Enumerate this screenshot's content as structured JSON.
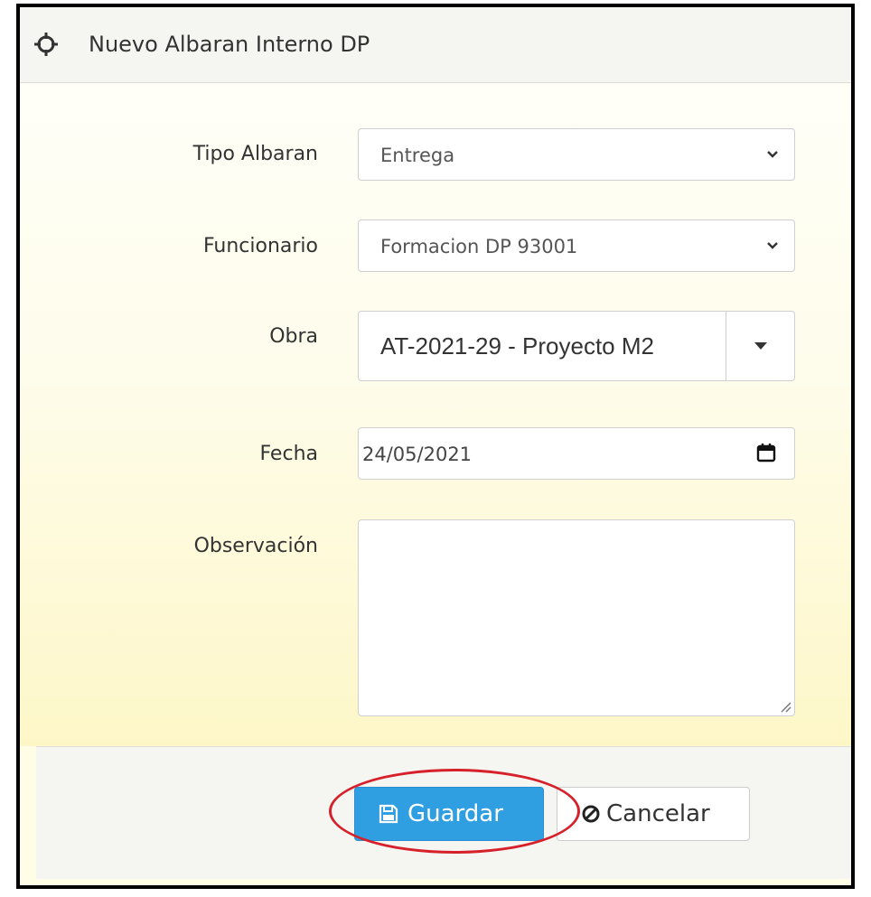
{
  "dialog": {
    "title": "Nuevo Albaran Interno DP",
    "title_icon": "crosshairs-icon"
  },
  "form": {
    "tipo_albaran": {
      "label": "Tipo Albaran",
      "value": "Entrega"
    },
    "funcionario": {
      "label": "Funcionario",
      "value": "Formacion DP 93001"
    },
    "obra": {
      "label": "Obra",
      "value": "AT-2021-29 - Proyecto M2"
    },
    "fecha": {
      "label": "Fecha",
      "value": "24/05/2021"
    },
    "observacion": {
      "label": "Observación",
      "value": ""
    }
  },
  "actions": {
    "save": {
      "label": "Guardar",
      "icon": "floppy-disk-icon"
    },
    "cancel": {
      "label": "Cancelar",
      "icon": "ban-icon"
    }
  },
  "colors": {
    "primary_button": "#2f9fe1",
    "highlight_circle": "#d6202a",
    "body_gradient_end": "#fdf7c8"
  }
}
